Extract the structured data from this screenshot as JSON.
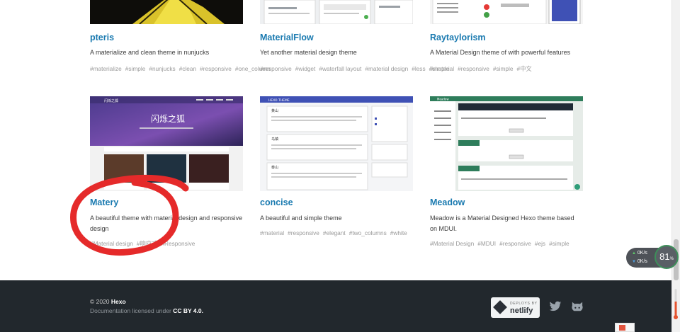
{
  "themes": [
    {
      "title": "pteris",
      "desc": "A materialize and clean theme in nunjucks",
      "tags": [
        "#materialize",
        "#simple",
        "#nunjucks",
        "#clean",
        "#responsive",
        "#one_column"
      ]
    },
    {
      "title": "MaterialFlow",
      "desc": "Yet another material design theme",
      "tags": [
        "#responsive",
        "#widget",
        "#waterfall layout",
        "#material design",
        "#less",
        "#simple"
      ]
    },
    {
      "title": "Raytaylorism",
      "desc": "A Material Design theme of with powerful features",
      "tags": [
        "#material",
        "#responsive",
        "#simple",
        "#中文"
      ]
    },
    {
      "title": "Matery",
      "desc": "A beautiful theme with material design and responsive design",
      "tags": [
        "#Material design",
        "#响应式",
        "#Responsive"
      ],
      "preview": {
        "banner_text": "闪烁之狐",
        "logo_text": "闪烁之狐"
      }
    },
    {
      "title": "concise",
      "desc": "A beautiful and simple theme",
      "tags": [
        "#material",
        "#responsive",
        "#elegant",
        "#two_columns",
        "#white"
      ],
      "preview": {
        "header_text": "HEXO THEME",
        "post_titles": [
          "黄山",
          "乌镇",
          "泰山"
        ]
      }
    },
    {
      "title": "Meadow",
      "desc": "Meadow is a Material Designed Hexo theme based on MDUI.",
      "tags": [
        "#Material Design",
        "#MDUI",
        "#responsive",
        "#ejs",
        "#simple"
      ],
      "preview": {
        "top_text": "Meadow"
      }
    }
  ],
  "footer": {
    "copyright_prefix": "© 2020 ",
    "copyright_brand": "Hexo",
    "license_prefix": "Documentation licensed under ",
    "license_link": "CC BY 4.0.",
    "netlify_top": "DEPLOYS BY",
    "netlify_bottom": "netlify",
    "icons": [
      "twitter-icon",
      "github-icon"
    ]
  },
  "network_widget": {
    "upload": "0K/s",
    "download": "0K/s",
    "percent": "81",
    "percent_unit": "%"
  },
  "colors": {
    "title_link": "#1a7ab0",
    "footer_bg": "#22282d",
    "annotation": "#e52a2a"
  }
}
